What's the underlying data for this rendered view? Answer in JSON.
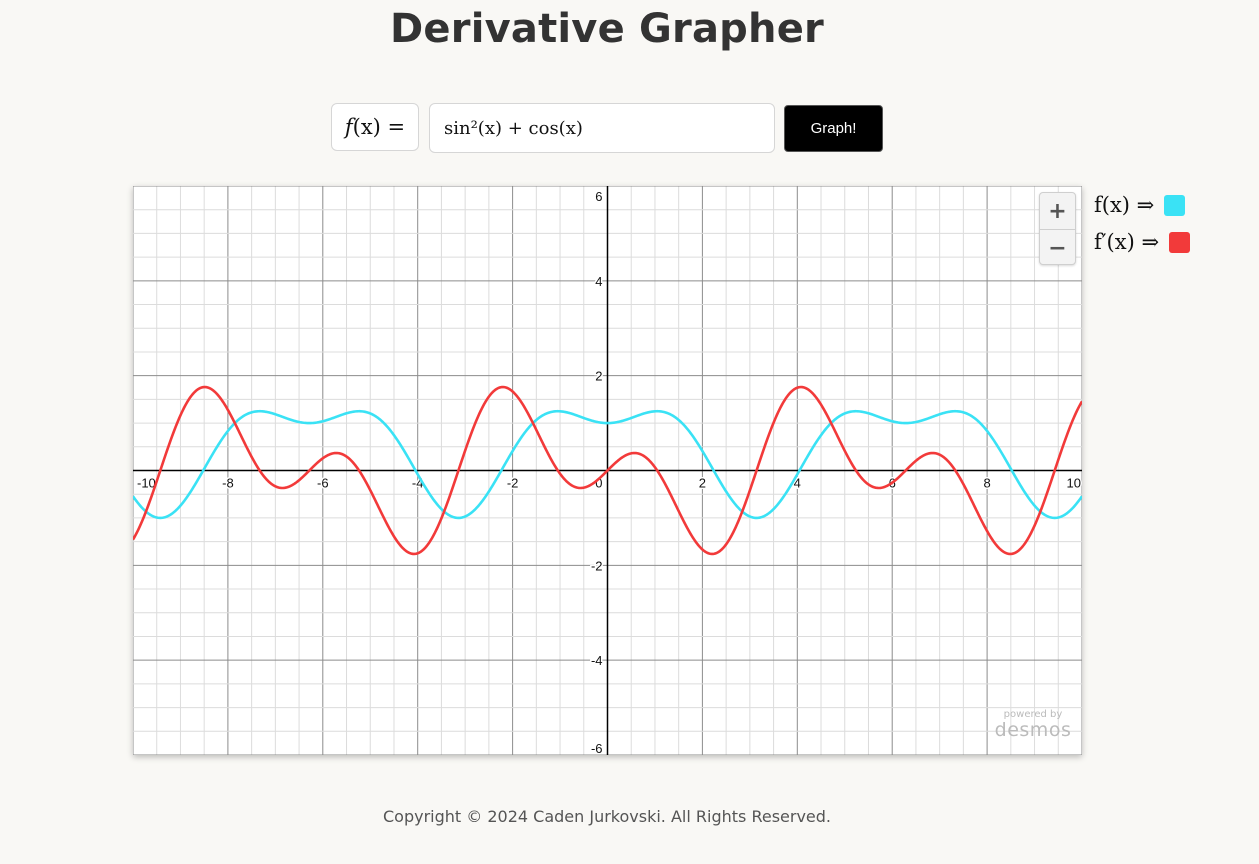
{
  "header": {
    "title": "Derivative Grapher"
  },
  "input": {
    "label_f": "f",
    "label_paren": "(x) =",
    "expression_display": "sin²(x) + cos(x)"
  },
  "toolbar": {
    "graph_label": "Graph!"
  },
  "graph": {
    "zoom_in": "+",
    "zoom_out": "−",
    "watermark_small": "powered by",
    "watermark_big": "desmos"
  },
  "legend": {
    "f_label": "f(x) ⇒",
    "fprime_label": "f′(x) ⇒",
    "f_color": "#3ae2f5",
    "fprime_color": "#f23a3a"
  },
  "footer": {
    "text": "Copyright © 2024 Caden Jurkovski. All Rights Reserved."
  },
  "chart_data": {
    "type": "line",
    "xlim": [
      -10,
      10
    ],
    "ylim": [
      -6,
      6
    ],
    "grid": true,
    "x_ticks": [
      -10,
      -8,
      -6,
      -4,
      -2,
      0,
      2,
      4,
      6,
      8,
      10
    ],
    "y_ticks": [
      -6,
      -4,
      -2,
      2,
      4,
      6
    ],
    "series": [
      {
        "name": "f(x)",
        "expression": "sin²(x) + cos(x)",
        "color": "#3ae2f5"
      },
      {
        "name": "f′(x)",
        "expression": "2sin(x)cos(x) − sin(x)",
        "color": "#f23a3a"
      }
    ]
  }
}
